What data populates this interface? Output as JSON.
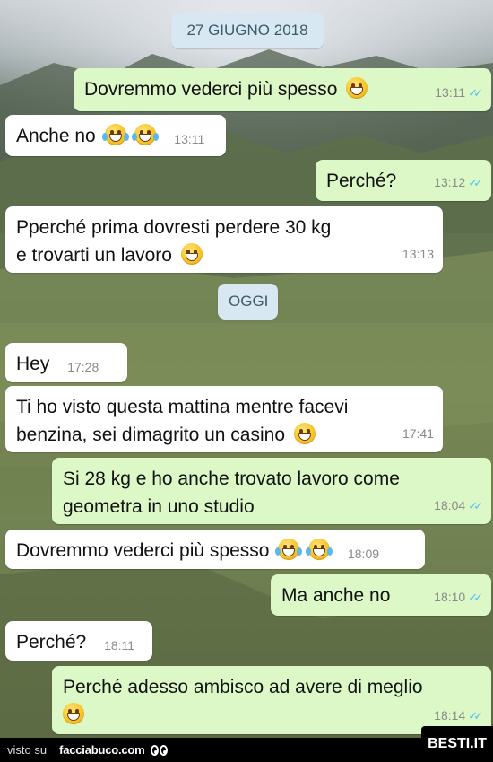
{
  "date_separators": [
    {
      "label": "27 GIUGNO 2018"
    },
    {
      "label": "OGGI"
    }
  ],
  "messages": [
    {
      "dir": "out",
      "text": "Dovremmo vederci più spesso",
      "emoji": [
        "grin"
      ],
      "time": "13:11",
      "read": true
    },
    {
      "dir": "in",
      "text": "Anche no",
      "emoji": [
        "tears",
        "tears"
      ],
      "time": "13:11"
    },
    {
      "dir": "out",
      "text": "Perché?",
      "emoji": [],
      "time": "13:12",
      "read": true
    },
    {
      "dir": "in",
      "text": "Pperché prima dovresti perdere 30 kg e trovarti un lavoro",
      "emoji": [
        "grin"
      ],
      "time": "13:13"
    },
    {
      "dir": "in",
      "text": "Hey",
      "emoji": [],
      "time": "17:28"
    },
    {
      "dir": "in",
      "text": "Ti ho visto questa mattina mentre facevi benzina, sei dimagrito un casino",
      "emoji": [
        "grin"
      ],
      "time": "17:41"
    },
    {
      "dir": "out",
      "text": "Si 28 kg e ho anche trovato lavoro come geometra in uno studio",
      "emoji": [],
      "time": "18:04",
      "read": true
    },
    {
      "dir": "in",
      "text": "Dovremmo vederci più spesso",
      "emoji": [
        "tears",
        "tears"
      ],
      "time": "18:09"
    },
    {
      "dir": "out",
      "text": "Ma anche no",
      "emoji": [],
      "time": "18:10",
      "read": true
    },
    {
      "dir": "in",
      "text": "Perché?",
      "emoji": [],
      "time": "18:11"
    },
    {
      "dir": "out",
      "text": "Perché adesso ambisco ad avere di meglio",
      "emoji": [
        "grin"
      ],
      "time": "18:14",
      "read": true
    }
  ],
  "footer": {
    "visto_su": "visto su",
    "site": "facciabuco.com",
    "watermark": "BESTI.IT"
  },
  "colors": {
    "incoming_bubble": "#ffffff",
    "outgoing_bubble": "#dcf8c6",
    "read_ticks": "#4fc3f7",
    "date_pill": "#d7e8f2"
  },
  "icons": [
    "double-check-icon",
    "grinning-face-emoji",
    "tears-of-joy-emoji",
    "eyes-logo-icon"
  ]
}
